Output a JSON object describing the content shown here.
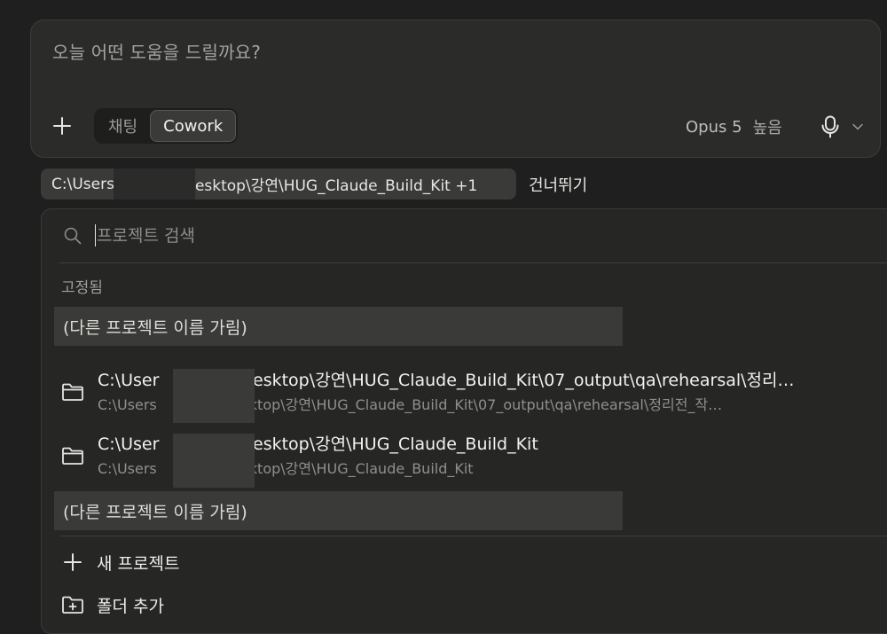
{
  "composer": {
    "placeholder": "오늘 어떤 도움을 드릴까요?",
    "modes": [
      {
        "label": "채팅",
        "active": false
      },
      {
        "label": "Cowork",
        "active": true
      }
    ],
    "model": "Opus 5",
    "effort": "높음"
  },
  "path_chip": {
    "prefix": "C:\\Users",
    "suffix": "esktop\\강연\\HUG_Claude_Build_Kit +1"
  },
  "skip_label": "건너뛰기",
  "project_picker": {
    "search_placeholder": "프로젝트 검색",
    "pinned_label": "고정됨",
    "hidden_name": "(다른 프로젝트 이름 가림)",
    "projects": [
      {
        "title_prefix": "C:\\User",
        "title_suffix": "Desktop\\강연\\HUG_Claude_Build_Kit\\07_output\\qa\\rehearsal\\정리…",
        "path_prefix": "C:\\Users",
        "path_suffix": "eesktop\\강연\\HUG_Claude_Build_Kit\\07_output\\qa\\rehearsal\\정리전_작…"
      },
      {
        "title_prefix": "C:\\User",
        "title_suffix": "Desktop\\강연\\HUG_Claude_Build_Kit",
        "path_prefix": "C:\\Users",
        "path_suffix": "eesktop\\강연\\HUG_Claude_Build_Kit"
      }
    ],
    "new_project_label": "새 프로젝트",
    "add_folder_label": "폴더 추가"
  },
  "colors": {
    "background": "#1f1f1f",
    "surface": "#2b2b2a",
    "highlight": "#3a3a38"
  }
}
